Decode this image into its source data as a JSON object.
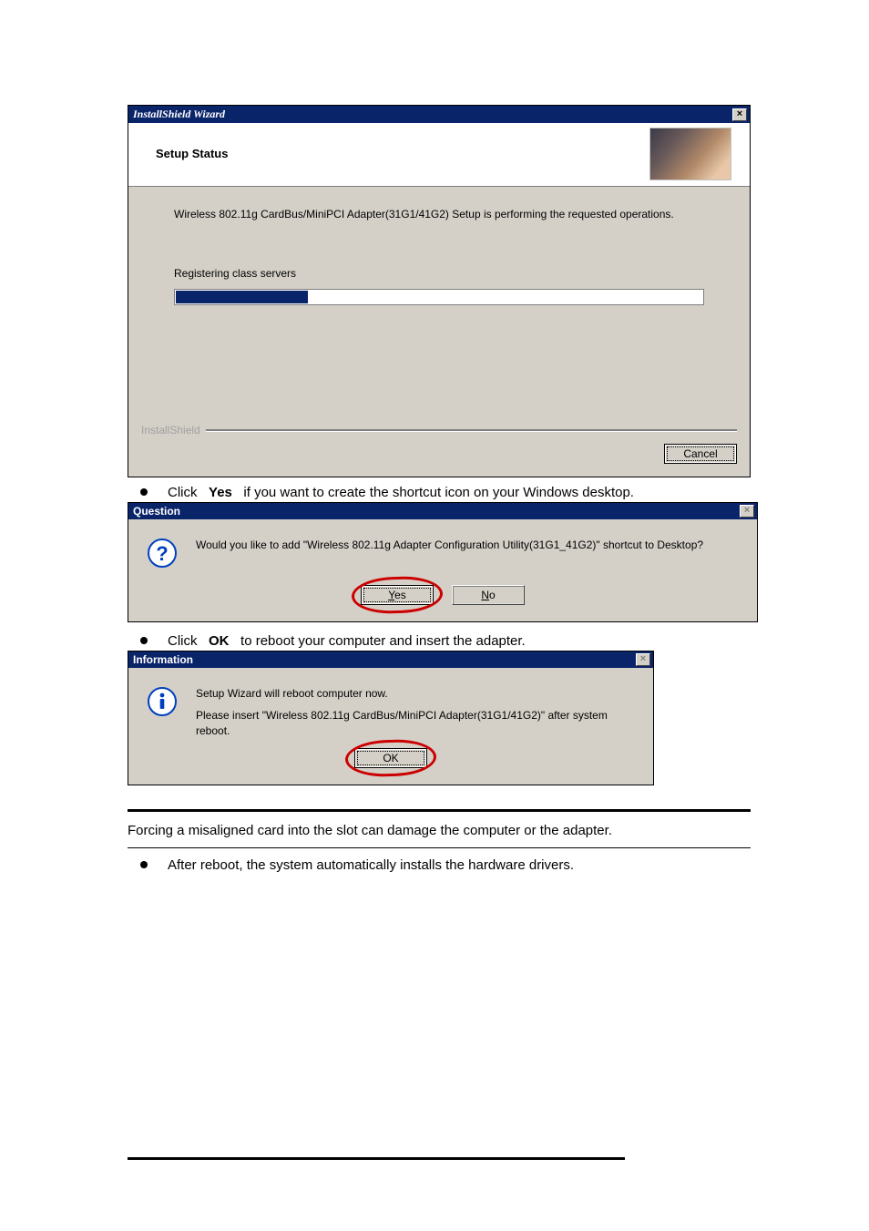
{
  "wizard": {
    "title": "InstallShield Wizard",
    "header": "Setup Status",
    "description": "Wireless 802.11g CardBus/MiniPCI Adapter(31G1/41G2) Setup is performing the requested operations.",
    "status": "Registering class servers",
    "brand": "InstallShield",
    "cancel": "Cancel",
    "progress_percent": 25
  },
  "bullet_yes": {
    "click": "Click",
    "hotkey": "Yes",
    "rest": "if you want to create the shortcut icon on your Windows desktop."
  },
  "question": {
    "title": "Question",
    "message": "Would you like to add \"Wireless 802.11g Adapter Configuration Utility(31G1_41G2)\" shortcut to Desktop?",
    "yes_u": "Y",
    "yes_rest": "es",
    "no_u": "N",
    "no_rest": "o"
  },
  "bullet_ok": {
    "click": "Click",
    "hotkey": "OK",
    "rest": "to reboot your computer and insert the adapter."
  },
  "info": {
    "title": "Information",
    "line1": "Setup Wizard will reboot computer now.",
    "line2": "Please insert \"Wireless 802.11g CardBus/MiniPCI Adapter(31G1/41G2)\" after system reboot.",
    "ok": "OK"
  },
  "caution": "Forcing a misaligned card into the slot can damage the computer or the adapter.",
  "after_reboot": "After reboot, the system automatically installs the hardware drivers."
}
